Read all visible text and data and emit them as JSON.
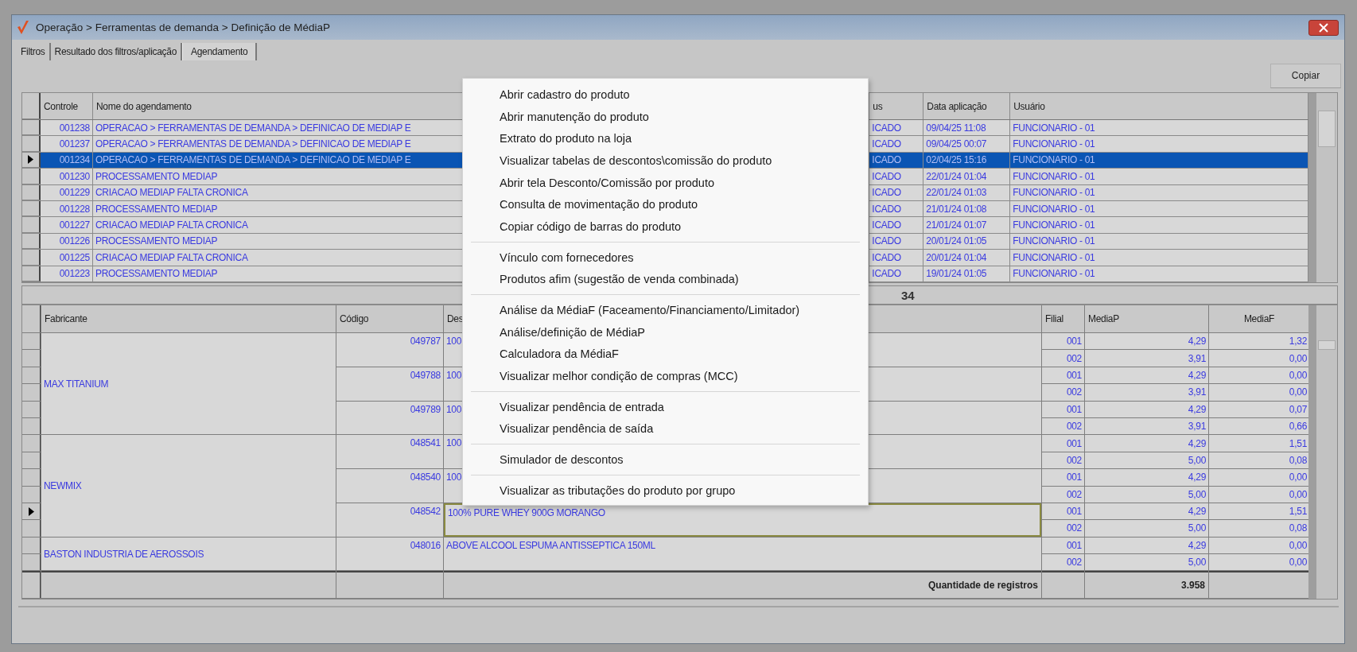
{
  "window": {
    "title": "Operação > Ferramentas de demanda > Definição de MédiaP"
  },
  "tabs": [
    {
      "label": "Filtros",
      "selected": false
    },
    {
      "label": "Resultado dos filtros/aplicação",
      "selected": false
    },
    {
      "label": "Agendamento",
      "selected": true
    }
  ],
  "copy_button": "Copiar",
  "schedule_table": {
    "columns": [
      "Controle",
      "Nome do agendamento",
      "us",
      "Data aplicação",
      "Usuário"
    ],
    "rows": [
      {
        "controle": "001238",
        "nome": "OPERACAO > FERRAMENTAS DE DEMANDA > DEFINICAO DE MEDIAP E",
        "status": "ICADO",
        "data": "09/04/25 11:08",
        "usuario": "FUNCIONARIO - 01",
        "selected": false
      },
      {
        "controle": "001237",
        "nome": "OPERACAO > FERRAMENTAS DE DEMANDA > DEFINICAO DE MEDIAP E",
        "status": "ICADO",
        "data": "09/04/25 00:07",
        "usuario": "FUNCIONARIO - 01",
        "selected": false
      },
      {
        "controle": "001234",
        "nome": "OPERACAO > FERRAMENTAS DE DEMANDA > DEFINICAO DE MEDIAP E",
        "status": "ICADO",
        "data": "02/04/25 15:16",
        "usuario": "FUNCIONARIO - 01",
        "selected": true
      },
      {
        "controle": "001230",
        "nome": "PROCESSAMENTO MEDIAP",
        "status": "ICADO",
        "data": "22/01/24 01:04",
        "usuario": "FUNCIONARIO - 01",
        "selected": false
      },
      {
        "controle": "001229",
        "nome": "CRIACAO MEDIAP FALTA CRONICA",
        "status": "ICADO",
        "data": "22/01/24 01:03",
        "usuario": "FUNCIONARIO - 01",
        "selected": false
      },
      {
        "controle": "001228",
        "nome": "PROCESSAMENTO MEDIAP",
        "status": "ICADO",
        "data": "21/01/24 01:08",
        "usuario": "FUNCIONARIO - 01",
        "selected": false
      },
      {
        "controle": "001227",
        "nome": "CRIACAO MEDIAP FALTA CRONICA",
        "status": "ICADO",
        "data": "21/01/24 01:07",
        "usuario": "FUNCIONARIO - 01",
        "selected": false
      },
      {
        "controle": "001226",
        "nome": "PROCESSAMENTO MEDIAP",
        "status": "ICADO",
        "data": "20/01/24 01:05",
        "usuario": "FUNCIONARIO - 01",
        "selected": false
      },
      {
        "controle": "001225",
        "nome": "CRIACAO MEDIAP FALTA CRONICA",
        "status": "ICADO",
        "data": "20/01/24 01:04",
        "usuario": "FUNCIONARIO - 01",
        "selected": false
      },
      {
        "controle": "001223",
        "nome": "PROCESSAMENTO MEDIAP",
        "status": "ICADO",
        "data": "19/01/24 01:05",
        "usuario": "FUNCIONARIO - 01",
        "selected": false
      }
    ]
  },
  "summary_bar": "34",
  "products_table": {
    "columns": [
      "Fabricante",
      "Código",
      "Des",
      "Filial",
      "MediaP",
      "MediaF"
    ],
    "groups": [
      {
        "fabricante": "MAX TITANIUM",
        "products": [
          {
            "codigo": "049787",
            "descricao": "100",
            "selected": false,
            "filiais": [
              {
                "filial": "001",
                "mediap": "4,29",
                "mediaf": "1,32"
              },
              {
                "filial": "002",
                "mediap": "3,91",
                "mediaf": "0,00"
              }
            ]
          },
          {
            "codigo": "049788",
            "descricao": "100",
            "selected": false,
            "filiais": [
              {
                "filial": "001",
                "mediap": "4,29",
                "mediaf": "0,00"
              },
              {
                "filial": "002",
                "mediap": "3,91",
                "mediaf": "0,00"
              }
            ]
          },
          {
            "codigo": "049789",
            "descricao": "100",
            "selected": false,
            "filiais": [
              {
                "filial": "001",
                "mediap": "4,29",
                "mediaf": "0,07"
              },
              {
                "filial": "002",
                "mediap": "3,91",
                "mediaf": "0,66"
              }
            ]
          }
        ]
      },
      {
        "fabricante": "NEWMIX",
        "products": [
          {
            "codigo": "048541",
            "descricao": "100",
            "selected": false,
            "filiais": [
              {
                "filial": "001",
                "mediap": "4,29",
                "mediaf": "1,51"
              },
              {
                "filial": "002",
                "mediap": "5,00",
                "mediaf": "0,08"
              }
            ]
          },
          {
            "codigo": "048540",
            "descricao": "100",
            "selected": false,
            "filiais": [
              {
                "filial": "001",
                "mediap": "4,29",
                "mediaf": "0,00"
              },
              {
                "filial": "002",
                "mediap": "5,00",
                "mediaf": "0,00"
              }
            ]
          },
          {
            "codigo": "048542",
            "descricao": "100% PURE WHEY 900G MORANGO",
            "selected": true,
            "filiais": [
              {
                "filial": "001",
                "mediap": "4,29",
                "mediaf": "1,51"
              },
              {
                "filial": "002",
                "mediap": "5,00",
                "mediaf": "0,08"
              }
            ]
          }
        ]
      },
      {
        "fabricante": "BASTON INDUSTRIA DE AEROSSOIS",
        "products": [
          {
            "codigo": "048016",
            "descricao": "ABOVE ALCOOL ESPUMA ANTISSEPTICA 150ML",
            "selected": false,
            "filiais": [
              {
                "filial": "001",
                "mediap": "4,29",
                "mediaf": "0,00"
              },
              {
                "filial": "002",
                "mediap": "5,00",
                "mediaf": "0,00"
              }
            ]
          }
        ]
      }
    ],
    "footer": {
      "label": "Quantidade de registros",
      "total": "3.958"
    }
  },
  "context_menu": {
    "sections": [
      [
        "Abrir cadastro do produto",
        "Abrir manutenção do produto",
        "Extrato do produto na loja",
        "Visualizar tabelas de descontos\\comissão do produto",
        "Abrir tela Desconto/Comissão por produto",
        "Consulta de movimentação do produto",
        "Copiar código de barras do produto"
      ],
      [
        "Vínculo com fornecedores",
        "Produtos afim (sugestão de venda combinada)"
      ],
      [
        "Análise da MédiaF (Faceamento/Financiamento/Limitador)",
        "Análise/definição de MédiaP",
        "Calculadora da MédiaF",
        "Visualizar melhor condição de compras (MCC)"
      ],
      [
        "Visualizar pendência de entrada",
        "Visualizar pendência de saída"
      ],
      [
        "Simulador de descontos"
      ],
      [
        "Visualizar as tributações do produto por grupo"
      ]
    ]
  }
}
